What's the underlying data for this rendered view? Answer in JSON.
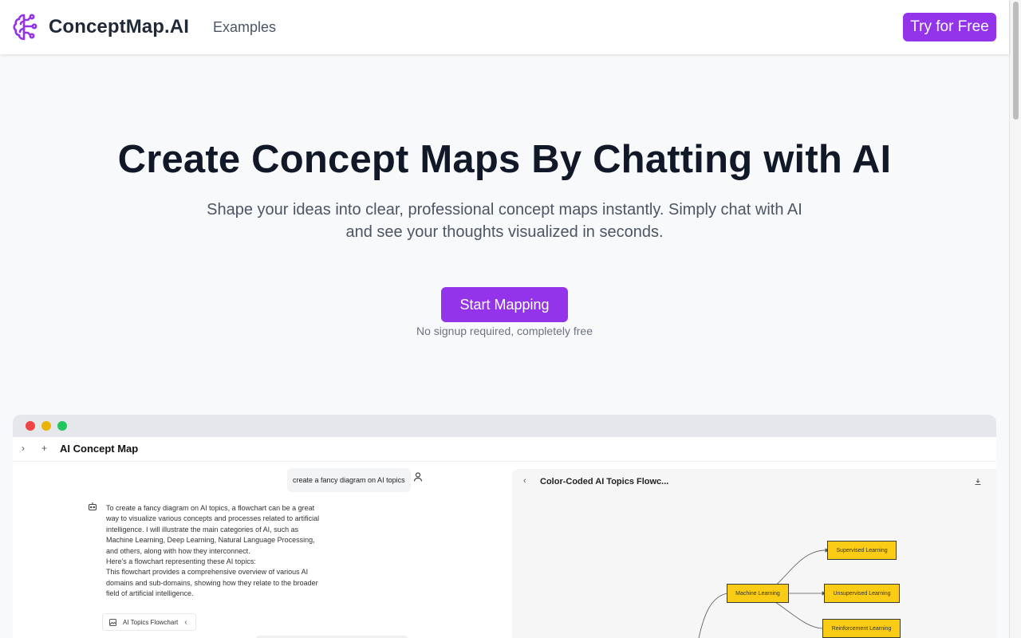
{
  "header": {
    "brand": "ConceptMap.AI",
    "nav": [
      "Examples"
    ],
    "cta_label": "Try for Free"
  },
  "hero": {
    "title": "Create Concept Maps By Chatting with AI",
    "subtitle": "Shape your ideas into clear, professional concept maps instantly. Simply chat with AI and see your thoughts visualized in seconds.",
    "cta_label": "Start Mapping",
    "note": "No signup required, completely free"
  },
  "mockup": {
    "app_title": "AI Concept Map",
    "user_message": "create a fancy diagram on AI topics",
    "bot_paragraphs": [
      "To create a fancy diagram on AI topics, a flowchart can be a great way to visualize various concepts and processes related to artificial intelligence. I will illustrate the main categories of AI, such as Machine Learning, Deep Learning, Natural Language Processing, and others, along with how they interconnect.",
      "Here's a flowchart representing these AI topics:",
      "This flowchart provides a comprehensive overview of various AI domains and sub-domains, showing how they relate to the broader field of artificial intelligence."
    ],
    "chip_label": "AI Topics Flowchart",
    "canvas_title": "Color-Coded AI Topics Flowc...",
    "nodes": {
      "machine_learning": "Machine Learning",
      "supervised": "Supervised Learning",
      "unsupervised": "Unsupervised Learning",
      "reinforcement": "Reinforcement Learning"
    }
  },
  "colors": {
    "accent": "#9333ea",
    "node_fill": "#facc15",
    "traffic": [
      "#ef4444",
      "#eab308",
      "#22c55e"
    ]
  }
}
